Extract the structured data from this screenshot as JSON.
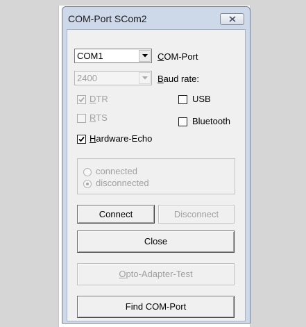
{
  "window": {
    "title": "COM-Port SCom2"
  },
  "port": {
    "value": "COM1",
    "label_first": "C",
    "label_rest": "OM-Port"
  },
  "baud": {
    "value": "2400",
    "label_first": "B",
    "label_rest": "aud rate:"
  },
  "checks": {
    "dtr": {
      "first": "D",
      "rest": "TR",
      "checked": true,
      "enabled": false
    },
    "rts": {
      "first": "R",
      "rest": "TS",
      "checked": false,
      "enabled": false
    },
    "usb": {
      "label": "USB",
      "checked": false
    },
    "bluetooth": {
      "label": "Bluetooth",
      "checked": false
    },
    "echo": {
      "first": "H",
      "rest": "ardware-Echo",
      "checked": true
    }
  },
  "status": {
    "connected": "connected",
    "disconnected": "disconnected",
    "selected": "disconnected"
  },
  "buttons": {
    "connect": "Connect",
    "disconnect": "Disconnect",
    "close": "Close",
    "opto_first": "O",
    "opto_rest": "pto-Adapter-Test",
    "find": "Find COM-Port"
  }
}
